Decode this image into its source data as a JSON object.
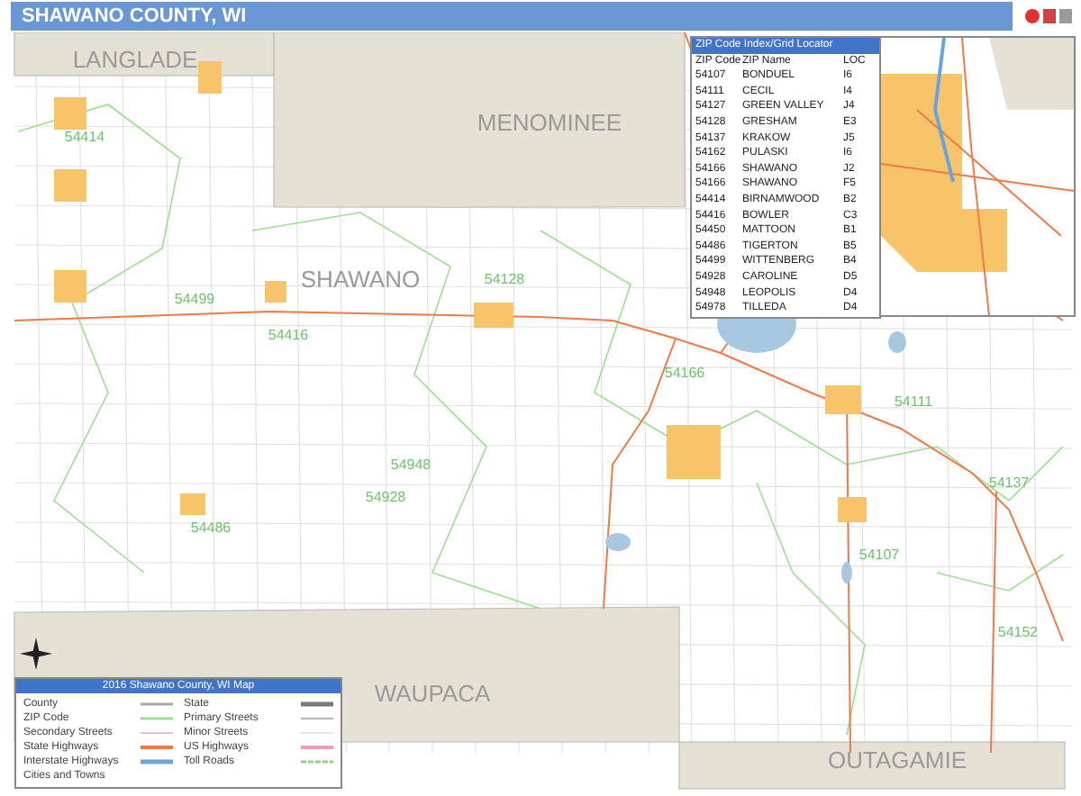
{
  "header": {
    "title": "SHAWANO COUNTY, WI"
  },
  "map": {
    "county_labels": [
      "LANGLADE",
      "MENOMINEE",
      "SHAWANO",
      "WAUPACA",
      "OUTAGAMIE"
    ],
    "zip_labels": [
      "54414",
      "54499",
      "54416",
      "54128",
      "54166",
      "54111",
      "54137",
      "54948",
      "54928",
      "54486",
      "54107",
      "54152"
    ]
  },
  "zip_index": {
    "title": "ZIP Code Index/Grid Locator",
    "columns": [
      "ZIP Code",
      "ZIP Name",
      "LOC"
    ],
    "rows": [
      {
        "zip": "54107",
        "name": "BONDUEL",
        "loc": "I6"
      },
      {
        "zip": "54111",
        "name": "CECIL",
        "loc": "I4"
      },
      {
        "zip": "54127",
        "name": "GREEN VALLEY",
        "loc": "J4"
      },
      {
        "zip": "54128",
        "name": "GRESHAM",
        "loc": "E3"
      },
      {
        "zip": "54137",
        "name": "KRAKOW",
        "loc": "J5"
      },
      {
        "zip": "54162",
        "name": "PULASKI",
        "loc": "I6"
      },
      {
        "zip": "54166",
        "name": "SHAWANO",
        "loc": "J2"
      },
      {
        "zip": "54166",
        "name": "SHAWANO",
        "loc": "F5"
      },
      {
        "zip": "54414",
        "name": "BIRNAMWOOD",
        "loc": "B2"
      },
      {
        "zip": "54416",
        "name": "BOWLER",
        "loc": "C3"
      },
      {
        "zip": "54450",
        "name": "MATTOON",
        "loc": "B1"
      },
      {
        "zip": "54486",
        "name": "TIGERTON",
        "loc": "B5"
      },
      {
        "zip": "54499",
        "name": "WITTENBERG",
        "loc": "B4"
      },
      {
        "zip": "54928",
        "name": "CAROLINE",
        "loc": "D5"
      },
      {
        "zip": "54948",
        "name": "LEOPOLIS",
        "loc": "D4"
      },
      {
        "zip": "54978",
        "name": "TILLEDA",
        "loc": "D4"
      }
    ]
  },
  "legend": {
    "title": "2016 Shawano County, WI Map",
    "items": [
      {
        "label": "County",
        "kind": "county"
      },
      {
        "label": "State",
        "kind": "state"
      },
      {
        "label": "ZIP Code",
        "kind": "zip"
      },
      {
        "label": "Primary Streets",
        "kind": "primary"
      },
      {
        "label": "Secondary Streets",
        "kind": "secondary"
      },
      {
        "label": "Minor Streets",
        "kind": "minor"
      },
      {
        "label": "State Highways",
        "kind": "statehwy"
      },
      {
        "label": "US Highways",
        "kind": "ushwy"
      },
      {
        "label": "Interstate Highways",
        "kind": "interstate"
      },
      {
        "label": "Toll Roads",
        "kind": "toll"
      }
    ],
    "cities_heading": "Cities and Towns"
  }
}
